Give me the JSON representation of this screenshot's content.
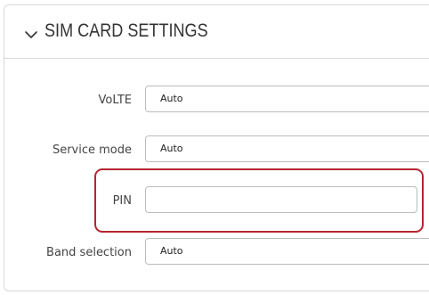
{
  "section": {
    "title": "SIM CARD SETTINGS",
    "toggle_icon": "chevron-down-icon",
    "expanded": true
  },
  "fields": [
    {
      "label": "VoLTE",
      "value": "Auto",
      "placeholder": ""
    },
    {
      "label": "Service mode",
      "value": "Auto",
      "placeholder": ""
    },
    {
      "label": "PIN",
      "value": "",
      "placeholder": ""
    },
    {
      "label": "Band selection",
      "value": "Auto",
      "placeholder": ""
    }
  ],
  "colors": {
    "highlight": "#b5262f",
    "text": "#333333",
    "border": "#bcbcbc"
  }
}
